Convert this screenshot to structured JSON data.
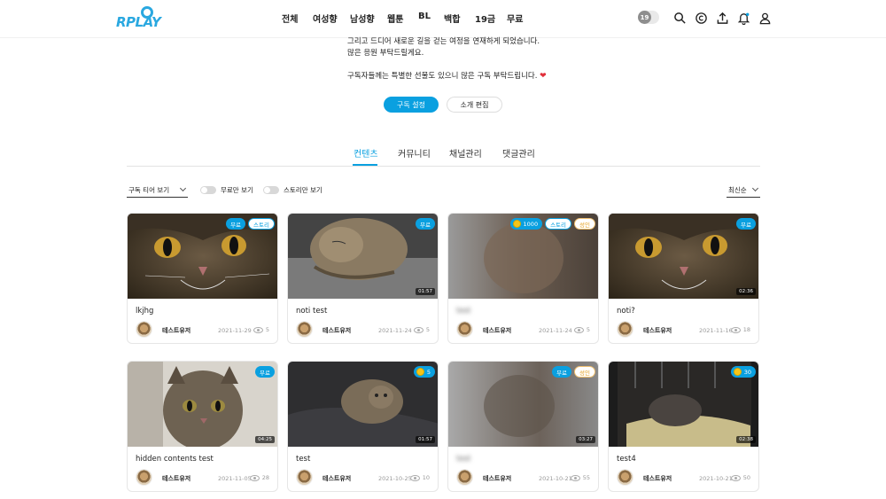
{
  "header": {
    "logo_text": "RPLAY",
    "nav": [
      "전체",
      "여성향",
      "남성향",
      "웹툰",
      "BL",
      "백합",
      "19금",
      "무료"
    ],
    "adult_badge": "19"
  },
  "intro": {
    "line1": "그리고 드디어 새로운 길을 걷는 여정을 연재하게 되었습니다.",
    "line2": "많은 응원 부탁드릴게요.",
    "line3": "구독자들께는 특별한 선물도 있으니 많은 구독 부탁드립니다.",
    "heart": "❤"
  },
  "buttons": {
    "subscribe": "구독 설정",
    "edit": "소개 편집"
  },
  "tabs": [
    "컨텐츠",
    "커뮤니티",
    "채널관리",
    "댓글관리"
  ],
  "filters": {
    "tier": "구독 티어 보기",
    "free_only": "무료만 보기",
    "story_only": "스토리만 보기",
    "sort": "최신순"
  },
  "cards": [
    {
      "title": "lkjhg",
      "author": "테스트유저",
      "date": "2021-11-29",
      "views": "5",
      "badges": [
        {
          "type": "free",
          "text": "무료"
        },
        {
          "type": "story",
          "text": "스토리"
        }
      ],
      "duration": ""
    },
    {
      "title": "noti test",
      "author": "테스트유저",
      "date": "2021-11-24",
      "views": "5",
      "badges": [
        {
          "type": "free",
          "text": "무료"
        }
      ],
      "duration": "01:57"
    },
    {
      "title": "test",
      "author": "테스트유저",
      "date": "2021-11-24",
      "views": "5",
      "badges": [
        {
          "type": "coin",
          "text": "1000"
        },
        {
          "type": "story",
          "text": "스토리"
        },
        {
          "type": "adult",
          "text": "성인"
        }
      ],
      "duration": ""
    },
    {
      "title": "noti?",
      "author": "테스트유저",
      "date": "2021-11-16",
      "views": "18",
      "badges": [
        {
          "type": "free",
          "text": "무료"
        }
      ],
      "duration": "02:36"
    },
    {
      "title": "hidden contents test",
      "author": "테스트유저",
      "date": "2021-11-05",
      "views": "28",
      "badges": [
        {
          "type": "free",
          "text": "무료"
        }
      ],
      "duration": "04:25"
    },
    {
      "title": "test",
      "author": "테스트유저",
      "date": "2021-10-25",
      "views": "10",
      "badges": [
        {
          "type": "coin",
          "text": "5"
        }
      ],
      "duration": "01:57"
    },
    {
      "title": "test",
      "author": "테스트유저",
      "date": "2021-10-21",
      "views": "55",
      "badges": [
        {
          "type": "free",
          "text": "무료"
        },
        {
          "type": "adult",
          "text": "성인"
        }
      ],
      "duration": "03:27"
    },
    {
      "title": "test4",
      "author": "테스트유저",
      "date": "2021-10-21",
      "views": "50",
      "badges": [
        {
          "type": "coin",
          "text": "30"
        }
      ],
      "duration": "02:38"
    }
  ]
}
